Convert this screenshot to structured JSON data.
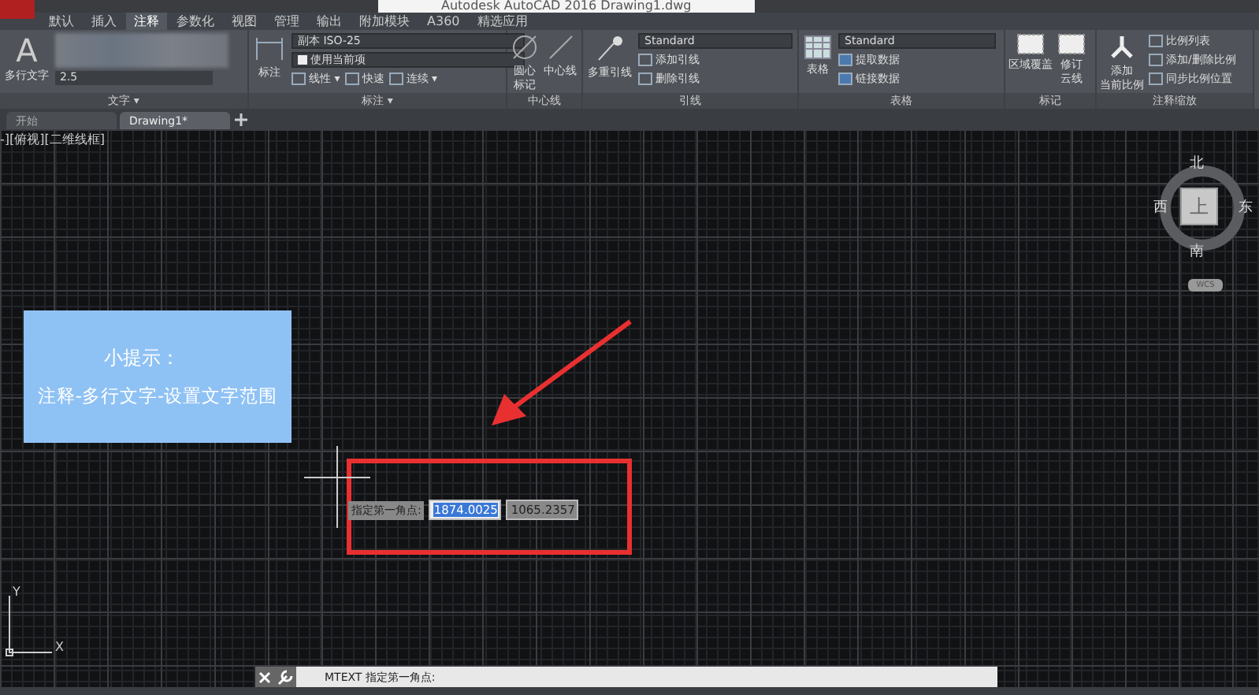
{
  "window": {
    "title": "Autodesk AutoCAD 2016    Drawing1.dwg"
  },
  "ribbon_tabs": [
    {
      "label": "默认",
      "selected": false
    },
    {
      "label": "插入",
      "selected": false
    },
    {
      "label": "注释",
      "selected": true
    },
    {
      "label": "参数化",
      "selected": false
    },
    {
      "label": "视图",
      "selected": false
    },
    {
      "label": "管理",
      "selected": false
    },
    {
      "label": "输出",
      "selected": false
    },
    {
      "label": "附加模块",
      "selected": false
    },
    {
      "label": "A360",
      "selected": false
    },
    {
      "label": "精选应用",
      "selected": false
    }
  ],
  "panels": {
    "text": {
      "title": "文字 ▾",
      "icon": "A",
      "big_label": "多行文字",
      "height_value": "2.5"
    },
    "dimension": {
      "title": "标注 ▾",
      "big_label": "标注",
      "style": "副本 ISO-25",
      "layer": "使用当前项",
      "tools": [
        "线性 ▾",
        "快速",
        "连续 ▾"
      ]
    },
    "centerline": {
      "title": "中心线",
      "buttons": [
        [
          "圆心",
          "标记"
        ],
        [
          "中心线"
        ]
      ]
    },
    "leader": {
      "title": "引线",
      "big_label": "多重引线",
      "style": "Standard",
      "tools": [
        "添加引线",
        "删除引线"
      ]
    },
    "table": {
      "title": "表格",
      "big_label": "表格",
      "style": "Standard",
      "tools": [
        "提取数据",
        "链接数据"
      ]
    },
    "markup": {
      "title": "标记",
      "buttons": [
        [
          "区域覆盖"
        ],
        [
          "修订",
          "云线"
        ]
      ]
    },
    "scale": {
      "title": "注释缩放",
      "big_label": [
        "添加",
        "当前比例"
      ],
      "tools": [
        "比例列表",
        "添加/删除比例",
        "同步比例位置"
      ]
    }
  },
  "doc_tabs": [
    {
      "label": "开始",
      "selected": false
    },
    {
      "label": "Drawing1*",
      "selected": true
    }
  ],
  "viewport_label": "-][俯视][二维线框]",
  "tip": {
    "title": "小提示：",
    "text": "注释-多行文字-设置文字范围"
  },
  "dynamic_input": {
    "prompt": "指定第一角点:",
    "fields": [
      {
        "value": "1874.0025",
        "selected": true
      },
      {
        "value": "1065.2357",
        "selected": false
      }
    ]
  },
  "viewcube": {
    "north": "北",
    "west": "西",
    "top": "上",
    "east": "东",
    "south": "南",
    "wcs": "WCS"
  },
  "ucs": {
    "y": "Y",
    "x": "X"
  },
  "command_line": {
    "text": "MTEXT 指定第一角点:"
  }
}
